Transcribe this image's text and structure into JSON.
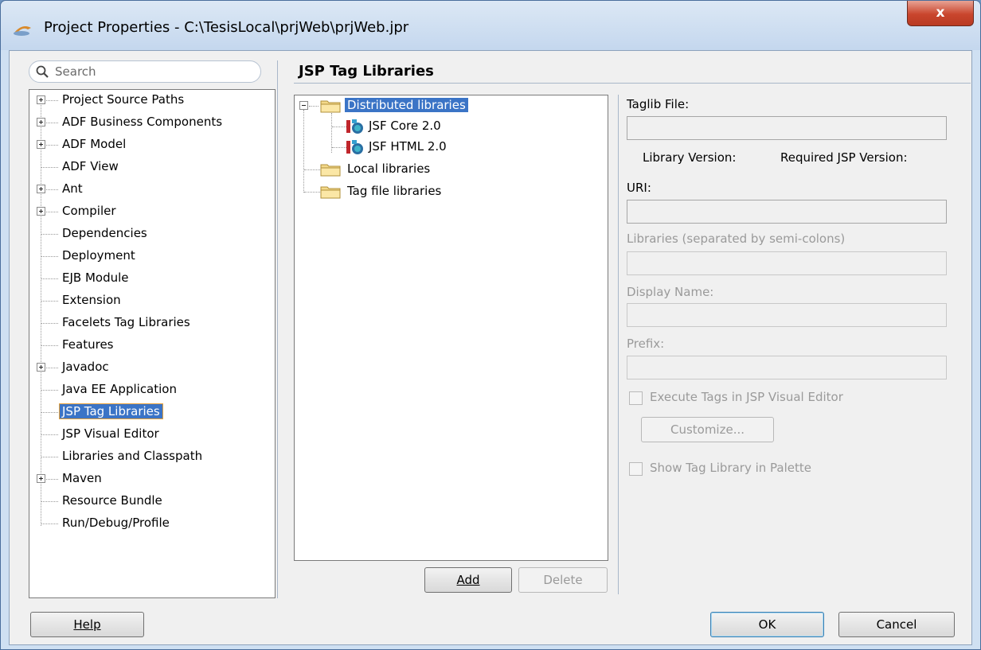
{
  "window": {
    "title": "Project Properties - C:\\TesisLocal\\prjWeb\\prjWeb.jpr",
    "close_label": "x"
  },
  "search": {
    "placeholder": "Search"
  },
  "nav": {
    "items": [
      {
        "label": "Project Source Paths",
        "expandable": true
      },
      {
        "label": "ADF Business Components",
        "expandable": true
      },
      {
        "label": "ADF Model",
        "expandable": true
      },
      {
        "label": "ADF View",
        "expandable": false
      },
      {
        "label": "Ant",
        "expandable": true
      },
      {
        "label": "Compiler",
        "expandable": true
      },
      {
        "label": "Dependencies",
        "expandable": false
      },
      {
        "label": "Deployment",
        "expandable": false
      },
      {
        "label": "EJB Module",
        "expandable": false
      },
      {
        "label": "Extension",
        "expandable": false
      },
      {
        "label": "Facelets Tag Libraries",
        "expandable": false
      },
      {
        "label": "Features",
        "expandable": false
      },
      {
        "label": "Javadoc",
        "expandable": true
      },
      {
        "label": "Java EE Application",
        "expandable": false
      },
      {
        "label": "JSP Tag Libraries",
        "expandable": false,
        "selected": true
      },
      {
        "label": "JSP Visual Editor",
        "expandable": false
      },
      {
        "label": "Libraries and Classpath",
        "expandable": false
      },
      {
        "label": "Maven",
        "expandable": true
      },
      {
        "label": "Resource Bundle",
        "expandable": false
      },
      {
        "label": "Run/Debug/Profile",
        "expandable": false
      }
    ]
  },
  "page": {
    "title": "JSP Tag Libraries"
  },
  "libs": {
    "distributed": "Distributed libraries",
    "jsf_core": "JSF Core 2.0",
    "jsf_html": "JSF HTML 2.0",
    "local": "Local libraries",
    "tagfile": "Tag file libraries"
  },
  "buttons": {
    "add": "Add",
    "delete": "Delete",
    "help": "Help",
    "ok": "OK",
    "cancel": "Cancel",
    "customize": "Customize..."
  },
  "form": {
    "taglib_file": "Taglib File:",
    "library_version": "Library Version:",
    "required_jsp_version": "Required JSP Version:",
    "uri": "URI:",
    "libraries": "Libraries (separated by semi-colons)",
    "display_name": "Display Name:",
    "prefix": "Prefix:",
    "execute_tags": "Execute Tags in JSP Visual Editor",
    "show_palette": "Show Tag Library in Palette"
  },
  "colors": {
    "selection": "#3b74c6",
    "titlebar": "#cfe0f2",
    "close_button": "#c9452d"
  }
}
